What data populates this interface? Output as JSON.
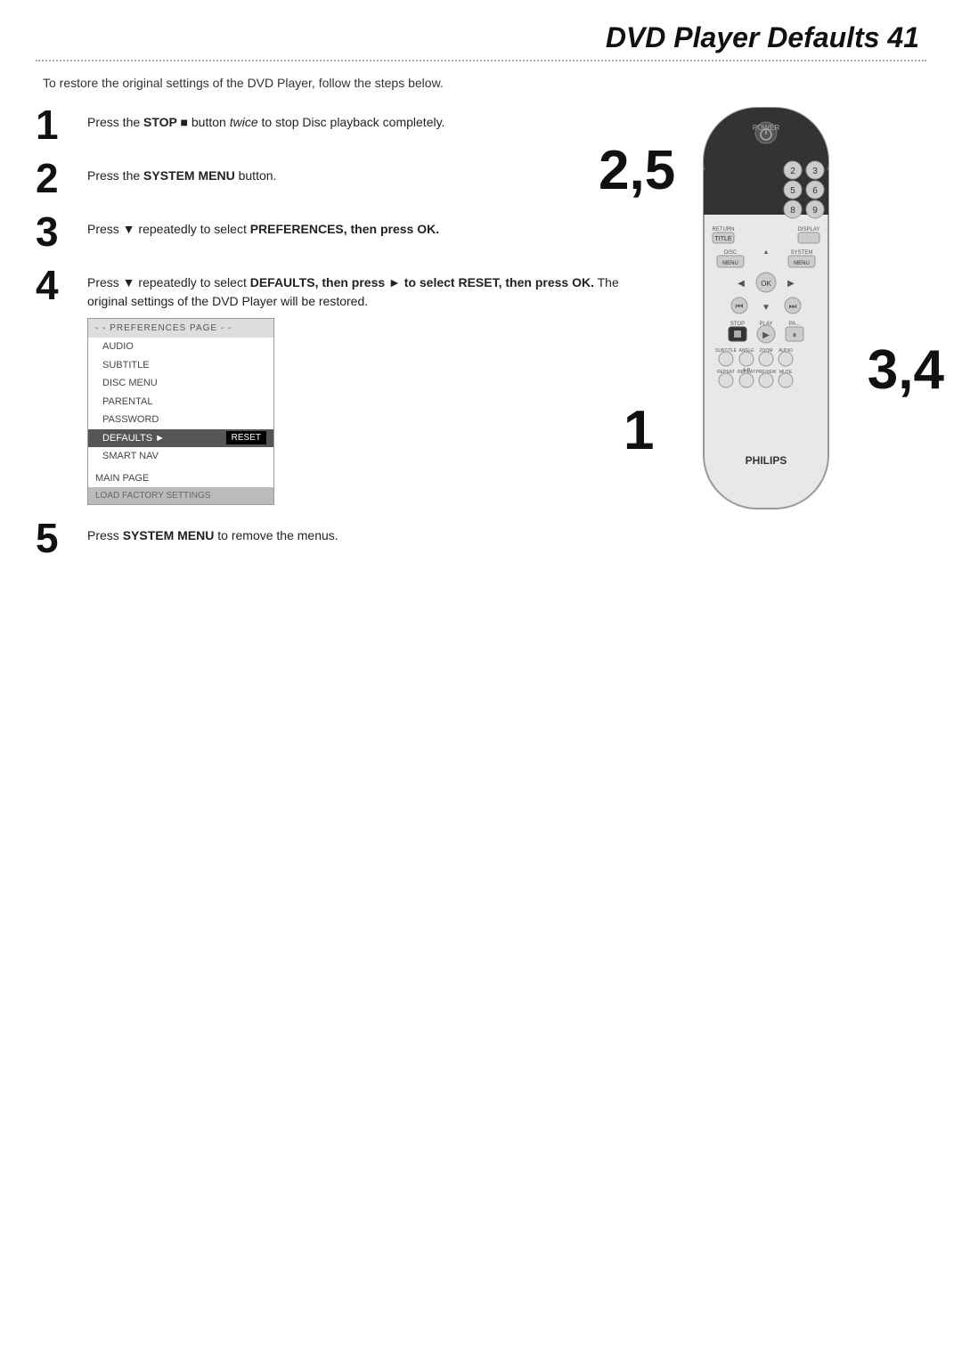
{
  "page": {
    "title": "DVD Player Defaults 41",
    "intro": "To restore the original settings of the DVD Player, follow the steps below.",
    "steps": [
      {
        "num": "1",
        "html": "Press the <b>STOP &#9632;</b> button <i>twice</i> to stop Disc playback completely."
      },
      {
        "num": "2",
        "html": "Press the <b>SYSTEM MENU</b> button."
      },
      {
        "num": "3",
        "html": "Press &#9660; repeatedly to select <b>PREFERENCES, then press OK.</b>"
      },
      {
        "num": "4",
        "html": "Press &#9660; repeatedly to select <b>DEFAULTS, then press &#9658; to select RESET, then press OK.</b> The original settings of the DVD Player will be restored."
      },
      {
        "num": "5",
        "html": "Press <b>SYSTEM MENU</b> to remove the menus."
      }
    ],
    "menu": {
      "header": "- - PREFERENCES PAGE - -",
      "items": [
        {
          "label": "AUDIO",
          "selected": false,
          "indent": false
        },
        {
          "label": "SUBTITLE",
          "selected": false,
          "indent": false
        },
        {
          "label": "DISC MENU",
          "selected": false,
          "indent": false
        },
        {
          "label": "PARENTAL",
          "selected": false,
          "indent": false
        },
        {
          "label": "PASSWORD",
          "selected": false,
          "indent": false
        },
        {
          "label": "DEFAULTS",
          "selected": true,
          "indent": false,
          "reset": "RESET"
        },
        {
          "label": "SMART NAV",
          "selected": false,
          "indent": false
        }
      ],
      "footer": "MAIN PAGE",
      "load": "LOAD FACTORY SETTINGS"
    },
    "remote_step_labels": [
      "2,5",
      "3,4",
      "1"
    ],
    "brand": "PHILIPS"
  }
}
